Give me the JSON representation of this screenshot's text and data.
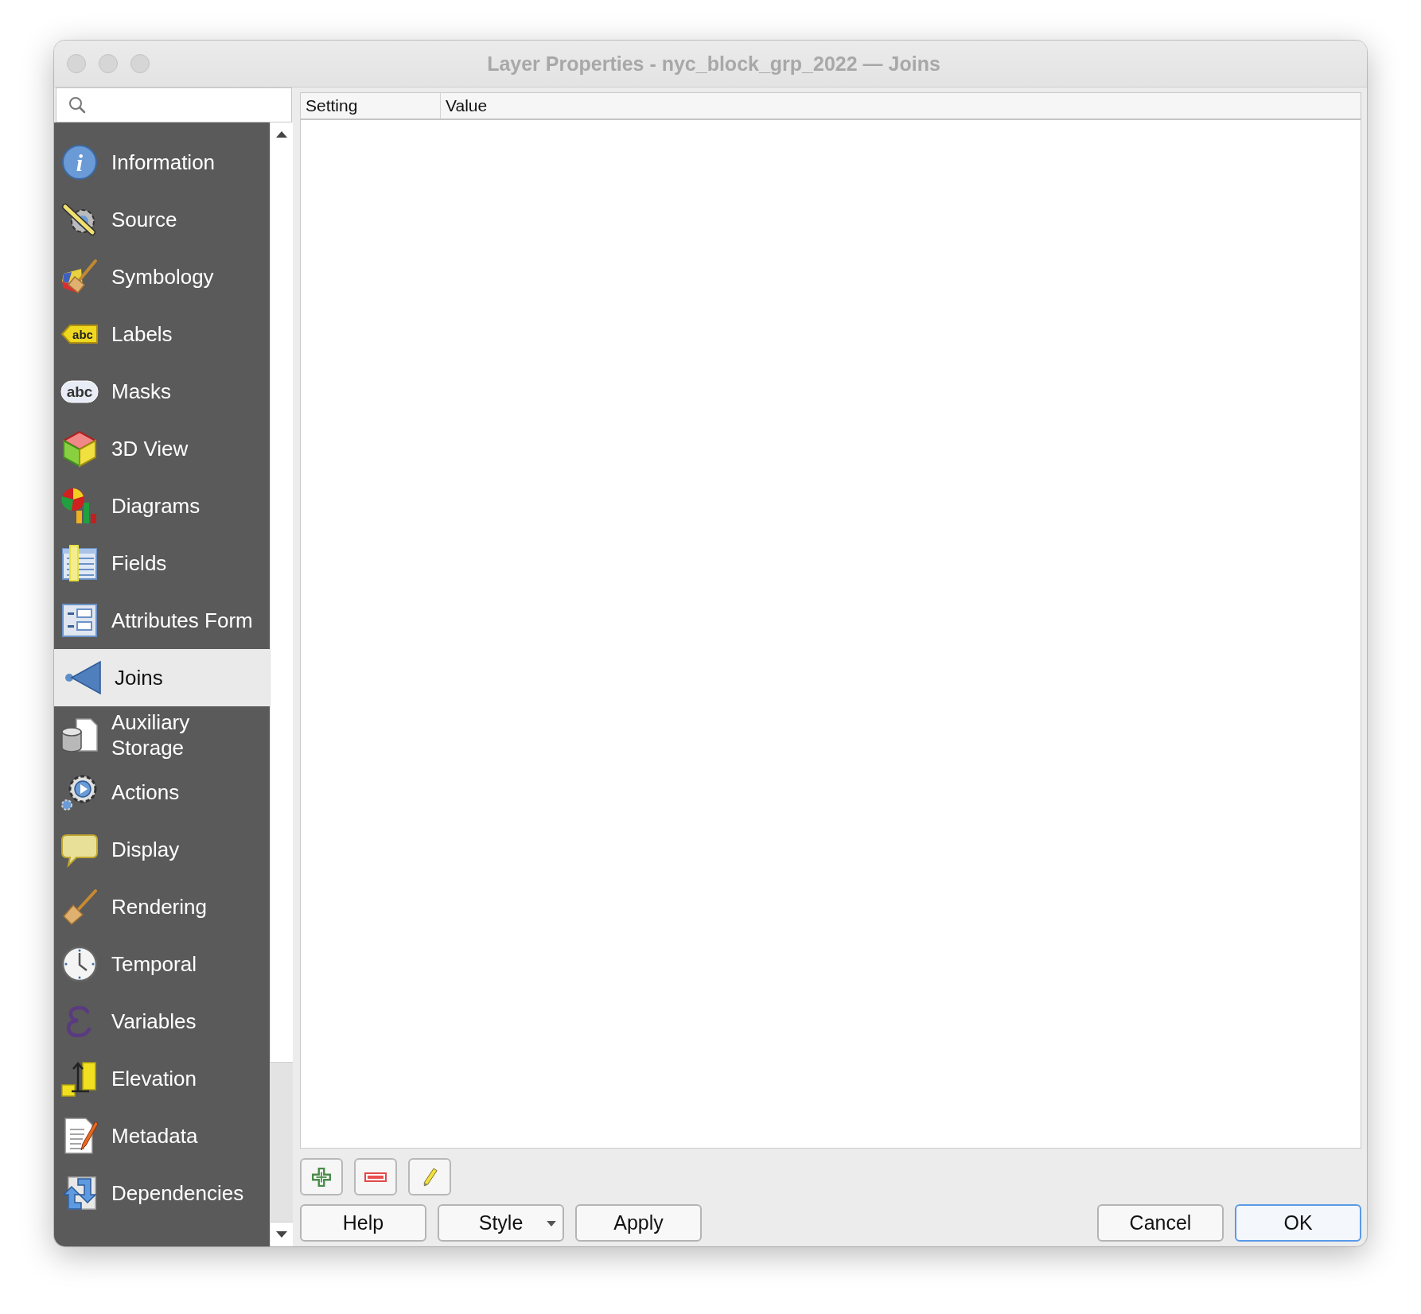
{
  "window": {
    "title": "Layer Properties - nyc_block_grp_2022 — Joins"
  },
  "sidebar": {
    "items": [
      {
        "label": "Information",
        "selected": false,
        "badge": "i"
      },
      {
        "label": "Source",
        "selected": false
      },
      {
        "label": "Symbology",
        "selected": false
      },
      {
        "label": "Labels",
        "selected": false,
        "badge": "abc"
      },
      {
        "label": "Masks",
        "selected": false,
        "badge": "abc"
      },
      {
        "label": "3D View",
        "selected": false
      },
      {
        "label": "Diagrams",
        "selected": false
      },
      {
        "label": "Fields",
        "selected": false
      },
      {
        "label": "Attributes Form",
        "selected": false
      },
      {
        "label": "Joins",
        "selected": true
      },
      {
        "label": "Auxiliary Storage",
        "selected": false
      },
      {
        "label": "Actions",
        "selected": false
      },
      {
        "label": "Display",
        "selected": false
      },
      {
        "label": "Rendering",
        "selected": false
      },
      {
        "label": "Temporal",
        "selected": false
      },
      {
        "label": "Variables",
        "selected": false
      },
      {
        "label": "Elevation",
        "selected": false
      },
      {
        "label": "Metadata",
        "selected": false
      },
      {
        "label": "Dependencies",
        "selected": false
      }
    ]
  },
  "table": {
    "columns": [
      "Setting",
      "Value"
    ]
  },
  "tools": [
    {
      "kind": "add"
    },
    {
      "kind": "remove"
    },
    {
      "kind": "edit"
    }
  ],
  "buttons_left": [
    {
      "label": "Help",
      "kind": "plain"
    },
    {
      "label": "Style",
      "kind": "menu"
    },
    {
      "label": "Apply",
      "kind": "plain"
    }
  ],
  "buttons_right": [
    {
      "label": "Cancel",
      "default": false
    },
    {
      "label": "OK",
      "default": true
    }
  ]
}
